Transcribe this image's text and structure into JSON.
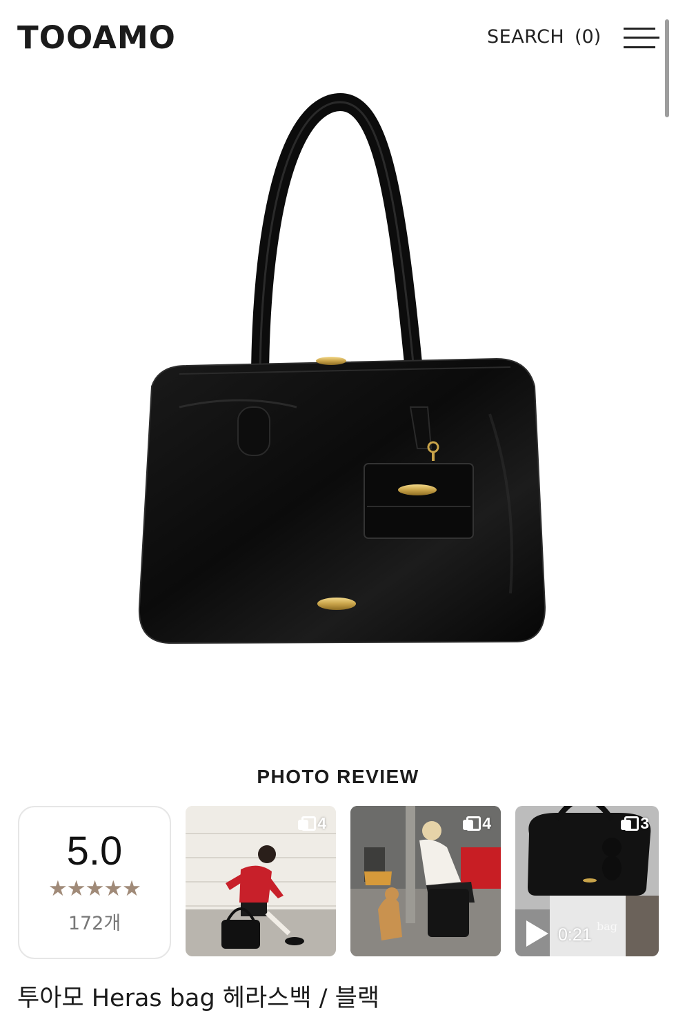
{
  "header": {
    "logo": "TOOAMO",
    "search_label": "SEARCH",
    "cart_label": "(0)"
  },
  "hero": {
    "image": "black-leather-shoulder-bag-product-photo"
  },
  "photo_review": {
    "title": "PHOTO REVIEW",
    "rating": {
      "score": "5.0",
      "stars": "★★★★★",
      "star_count": 5,
      "count": "172개",
      "star_color": "#a08a78"
    },
    "thumbnails": [
      {
        "kind": "photo",
        "scene": "woman-in-red-cardigan-with-bag",
        "badge": "4"
      },
      {
        "kind": "photo",
        "scene": "woman-crouching-with-dog-and-bag",
        "badge": "4"
      },
      {
        "kind": "video",
        "scene": "bag-with-keychain-closeup",
        "badge": "3",
        "duration": "0:21",
        "watermark": "bag"
      }
    ]
  },
  "product": {
    "title": "투아모 Heras bag 헤라스백 / 블랙"
  }
}
